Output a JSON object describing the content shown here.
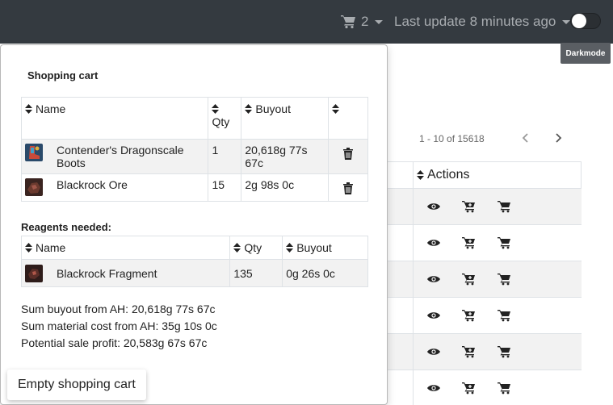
{
  "navbar": {
    "cart_count": "2",
    "last_update": "Last update 8 minutes ago",
    "darkmode_tooltip": "Darkmode"
  },
  "background_table": {
    "pagination": "1 - 10 of 15618",
    "actions_header": "Actions",
    "row_count": 6
  },
  "cart": {
    "title": "Shopping cart",
    "columns": {
      "name": "Name",
      "qty": "Qty",
      "buyout": "Buyout"
    },
    "items": [
      {
        "name": "Contender's Dragonscale Boots",
        "qty": "1",
        "buyout": "20,618g 77s 67c",
        "icon": "boots-item-icon"
      },
      {
        "name": "Blackrock Ore",
        "qty": "15",
        "buyout": "2g 98s 0c",
        "icon": "ore-item-icon"
      }
    ],
    "reagents_title": "Reagents needed:",
    "reagent_columns": {
      "name": "Name",
      "qty": "Qty",
      "buyout": "Buyout"
    },
    "reagents": [
      {
        "name": "Blackrock Fragment",
        "qty": "135",
        "buyout": "0g 26s 0c",
        "icon": "fragment-item-icon"
      }
    ],
    "sum_buyout": "Sum buyout from AH: 20,618g 77s 67c",
    "sum_material": "Sum material cost from AH: 35g 10s 0c",
    "potential_profit": "Potential sale profit: 20,583g 67s 67c",
    "empty_button": "Empty shopping cart"
  }
}
